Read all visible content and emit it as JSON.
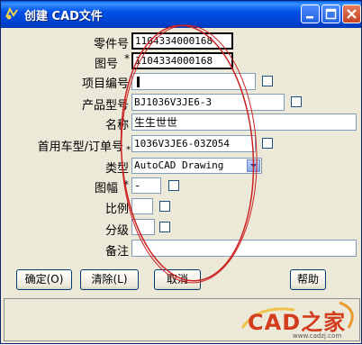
{
  "window": {
    "title": "创建 CAD文件"
  },
  "fields": {
    "part_number": {
      "label": "零件号",
      "value": "1104334000168"
    },
    "drawing_number": {
      "label": "图号",
      "required": "*",
      "value": "1104334000168"
    },
    "project_number": {
      "label": "项目编号",
      "value": ""
    },
    "product_model": {
      "label": "产品型号",
      "value": "BJ1036V3JE6-3"
    },
    "name": {
      "label": "名称",
      "value": "生生世世"
    },
    "first_vehicle_model": {
      "label": "首用车型/订单号",
      "required": "*",
      "value": "1036V3JE6-03Z054"
    },
    "type": {
      "label": "类型",
      "value": "AutoCAD Drawing"
    },
    "sheet_size": {
      "label": "图幅",
      "required": "*",
      "value": "-"
    },
    "scale": {
      "label": "比例",
      "value": ""
    },
    "grade": {
      "label": "分级",
      "value": ""
    },
    "remarks": {
      "label": "备注",
      "value": ""
    }
  },
  "buttons": {
    "ok": "确定(O)",
    "clear": "清除(L)",
    "cancel": "取消",
    "help": "帮助"
  },
  "watermark": {
    "logo_text": "CAD之家",
    "url": "www.cadzj.com"
  },
  "colors": {
    "titlebar": "#0054e3",
    "dialog_bg": "#ECE9D8",
    "annotation_circle": "#cc2222"
  }
}
